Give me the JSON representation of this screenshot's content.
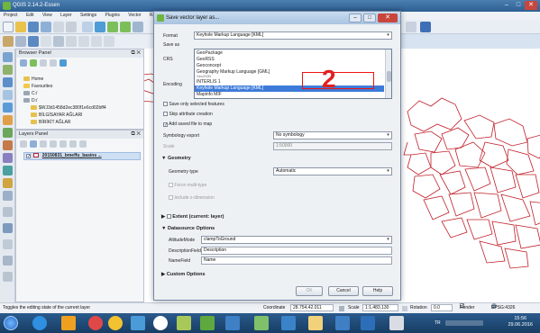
{
  "app": {
    "title": "QGIS 2.14.2-Essen",
    "window_controls": [
      "–",
      "□",
      "✕"
    ]
  },
  "menubar": [
    "Project",
    "Edit",
    "View",
    "Layer",
    "Settings",
    "Plugins",
    "Vector",
    "Raster",
    "Database",
    "Web",
    "Processing",
    "Help"
  ],
  "browser_panel": {
    "title": "Browser Panel",
    "controls": "⧉ ✕",
    "items": [
      {
        "label": "Home",
        "indent": 1
      },
      {
        "label": "Favourites",
        "indent": 1
      },
      {
        "label": "C:/",
        "indent": 1
      },
      {
        "label": "D:/",
        "indent": 1
      },
      {
        "label": "$WJ3d1458d2ec380f1e6cd02bff4",
        "indent": 2
      },
      {
        "label": "BİLGİSAYAR AĞLARI",
        "indent": 2
      },
      {
        "label": "BİRİKİT AĞLAR",
        "indent": 2
      }
    ]
  },
  "layers_panel": {
    "title": "Layers Panel",
    "controls": "⧉ ✕",
    "layer": "20150831_bmeffu_basins ..."
  },
  "dialog": {
    "title": "Save vector layer as...",
    "format_label": "Format",
    "format_value": "Keyhole Markup Language [KML]",
    "save_as_label": "Save as",
    "crs_label": "CRS",
    "encoding_label": "Encoding",
    "save_only_selected": "Save only selected features",
    "skip_attribute": "Skip attribute creation",
    "add_saved": "Add saved file to map",
    "symbology_export_label": "Symbology export",
    "symbology_export_value": "No symbology",
    "scale_label": "Scale",
    "scale_value": "1:50000",
    "format_options": [
      {
        "label": "GeoPackage",
        "selected": false
      },
      {
        "label": "GeoRSS",
        "selected": false
      },
      {
        "label": "Geoconcept",
        "selected": false
      },
      {
        "label": "Geography Markup Language [GML]",
        "selected": false
      },
      {
        "label": "GeoJSON",
        "selected": false
      },
      {
        "label": "INTERLIS 1",
        "selected": false
      },
      {
        "label": "Keyhole Markup Language [KML]",
        "selected": true
      },
      {
        "label": "Mapinfo MIF",
        "selected": false
      },
      {
        "label": "Mapinfo TAB",
        "selected": false
      }
    ],
    "geometry_section": "Geometry",
    "geometry_type_label": "Geometry type",
    "geometry_type_value": "Automatic",
    "force_multi": "Force multi-type",
    "include_z": "Include z-dimension",
    "extent_section": "Extent (current: layer)",
    "datasource_section": "Datasource Options",
    "altitude_label": "AltitudeMode",
    "altitude_value": "clampToGround",
    "description_label": "DescriptionField",
    "description_value": "Description",
    "namefield_label": "NameField",
    "namefield_value": "Name",
    "custom_section": "Custom Options",
    "ok": "OK",
    "cancel": "Cancel",
    "help": "Help"
  },
  "annotation": {
    "number": "2"
  },
  "statusbar": {
    "message": "Toggles the editing state of the current layer",
    "coordinate_label": "Coordinate",
    "coordinate_value": "28.754,42.011",
    "scale_label": "Scale",
    "scale_value": "1:1,483,130",
    "rotation_label": "Rotation",
    "rotation_value": "0.0",
    "render_label": "Render",
    "crs": "EPSG:4326"
  },
  "taskbar": {
    "time": "15:56",
    "date": "29.06.2016",
    "tray_lang": "TR"
  },
  "colors": {
    "polygon_stroke": "#c0202a",
    "selection": "#3d7bd8",
    "annotation": "#e02020"
  }
}
